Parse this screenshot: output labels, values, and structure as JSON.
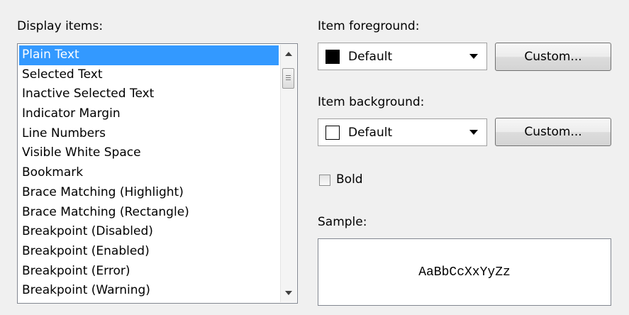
{
  "display_items": {
    "label": "Display items:",
    "items": [
      "Plain Text",
      "Selected Text",
      "Inactive Selected Text",
      "Indicator Margin",
      "Line Numbers",
      "Visible White Space",
      "Bookmark",
      "Brace Matching (Highlight)",
      "Brace Matching (Rectangle)",
      "Breakpoint (Disabled)",
      "Breakpoint (Enabled)",
      "Breakpoint (Error)",
      "Breakpoint (Warning)"
    ],
    "selected": "Plain Text"
  },
  "foreground": {
    "label": "Item foreground:",
    "value": "Default",
    "swatch_color": "#000000",
    "button": "Custom..."
  },
  "background": {
    "label": "Item background:",
    "value": "Default",
    "swatch_color": "#ffffff",
    "button": "Custom..."
  },
  "bold": {
    "label": "Bold",
    "checked": false
  },
  "sample": {
    "label": "Sample:",
    "text": "AaBbCcXxYyZz"
  },
  "colors": {
    "selection": "#3399ff",
    "window": "#f0f0f0"
  }
}
